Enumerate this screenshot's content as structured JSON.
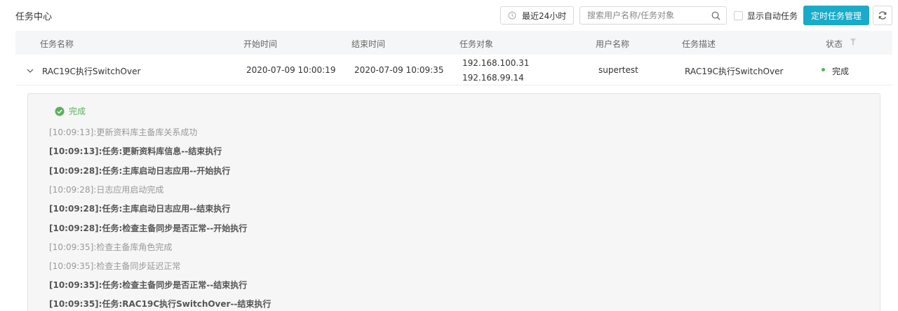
{
  "header": {
    "title": "任务中心",
    "time_filter": "最近24小时",
    "search_placeholder": "搜索用户名称/任务对象",
    "auto_task_label": "显示自动任务",
    "scheduled_button": "定时任务管理"
  },
  "table": {
    "columns": [
      "任务名称",
      "开始时间",
      "结束时间",
      "任务对象",
      "用户名称",
      "任务描述",
      "状态"
    ],
    "rows": [
      {
        "name": "RAC19C执行SwitchOver",
        "start": "2020-07-09 10:00:19",
        "end": "2020-07-09 10:09:35",
        "targets": [
          "192.168.100.31",
          "192.168.99.14"
        ],
        "user": "supertest",
        "description": "RAC19C执行SwitchOver",
        "status": "完成"
      }
    ]
  },
  "detail": {
    "status": "完成",
    "logs": [
      {
        "time": "[10:09:13]",
        "sep": ":",
        "text": "更新资料库主备库关系成功",
        "bold": false
      },
      {
        "time": "[10:09:13]",
        "sep": ":",
        "text": "任务:更新资料库信息--结束执行",
        "bold": true
      },
      {
        "time": "[10:09:28]",
        "sep": ":",
        "text": "任务:主库启动日志应用--开始执行",
        "bold": true
      },
      {
        "time": "[10:09:28]",
        "sep": ":",
        "text": "日志应用启动完成",
        "bold": false
      },
      {
        "time": "[10:09:28]",
        "sep": ":",
        "text": "任务:主库启动日志应用--结束执行",
        "bold": true
      },
      {
        "time": "[10:09:28]",
        "sep": ":",
        "text": "任务:检查主备同步是否正常--开始执行",
        "bold": true
      },
      {
        "time": "[10:09:35]",
        "sep": ":",
        "text": "检查主备库角色完成",
        "bold": false
      },
      {
        "time": "[10:09:35]",
        "sep": ":",
        "text": "检查主备同步延迟正常",
        "bold": false
      },
      {
        "time": "[10:09:35]",
        "sep": ":",
        "text": "任务:检查主备同步是否正常--结束执行",
        "bold": true
      },
      {
        "time": "[10:09:35]",
        "sep": ":",
        "text": "任务:RAC19C执行SwitchOver--结束执行",
        "bold": true
      }
    ]
  },
  "colors": {
    "primary": "#1aabc9",
    "success": "#5ab05d",
    "header_bg": "#f5f6f7",
    "panel_bg": "#f6f6f6"
  },
  "icons": {
    "time": "clock-icon",
    "search": "search-icon",
    "refresh": "refresh-icon",
    "sort": "filter-icon",
    "expand": "chevron-down-icon",
    "success": "check-circle-icon"
  }
}
